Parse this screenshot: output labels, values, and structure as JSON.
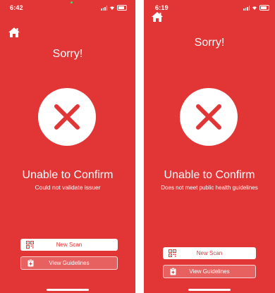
{
  "screens": [
    {
      "status_time": "6:42",
      "heading": "Sorry!",
      "title": "Unable to Confirm",
      "subtitle": "Could not validate issuer",
      "new_scan_label": "New Scan",
      "guidelines_label": "View Guidelines"
    },
    {
      "status_time": "6:19",
      "heading": "Sorry!",
      "title": "Unable to Confirm",
      "subtitle": "Does not meet public health guidelines",
      "new_scan_label": "New Scan",
      "guidelines_label": "View Guidelines"
    }
  ],
  "colors": {
    "background": "#e23535",
    "foreground": "#ffffff",
    "error_mark": "#e23535"
  },
  "icons": [
    "home-icon",
    "error-x-icon",
    "qr-code-icon",
    "clipboard-plus-icon"
  ]
}
